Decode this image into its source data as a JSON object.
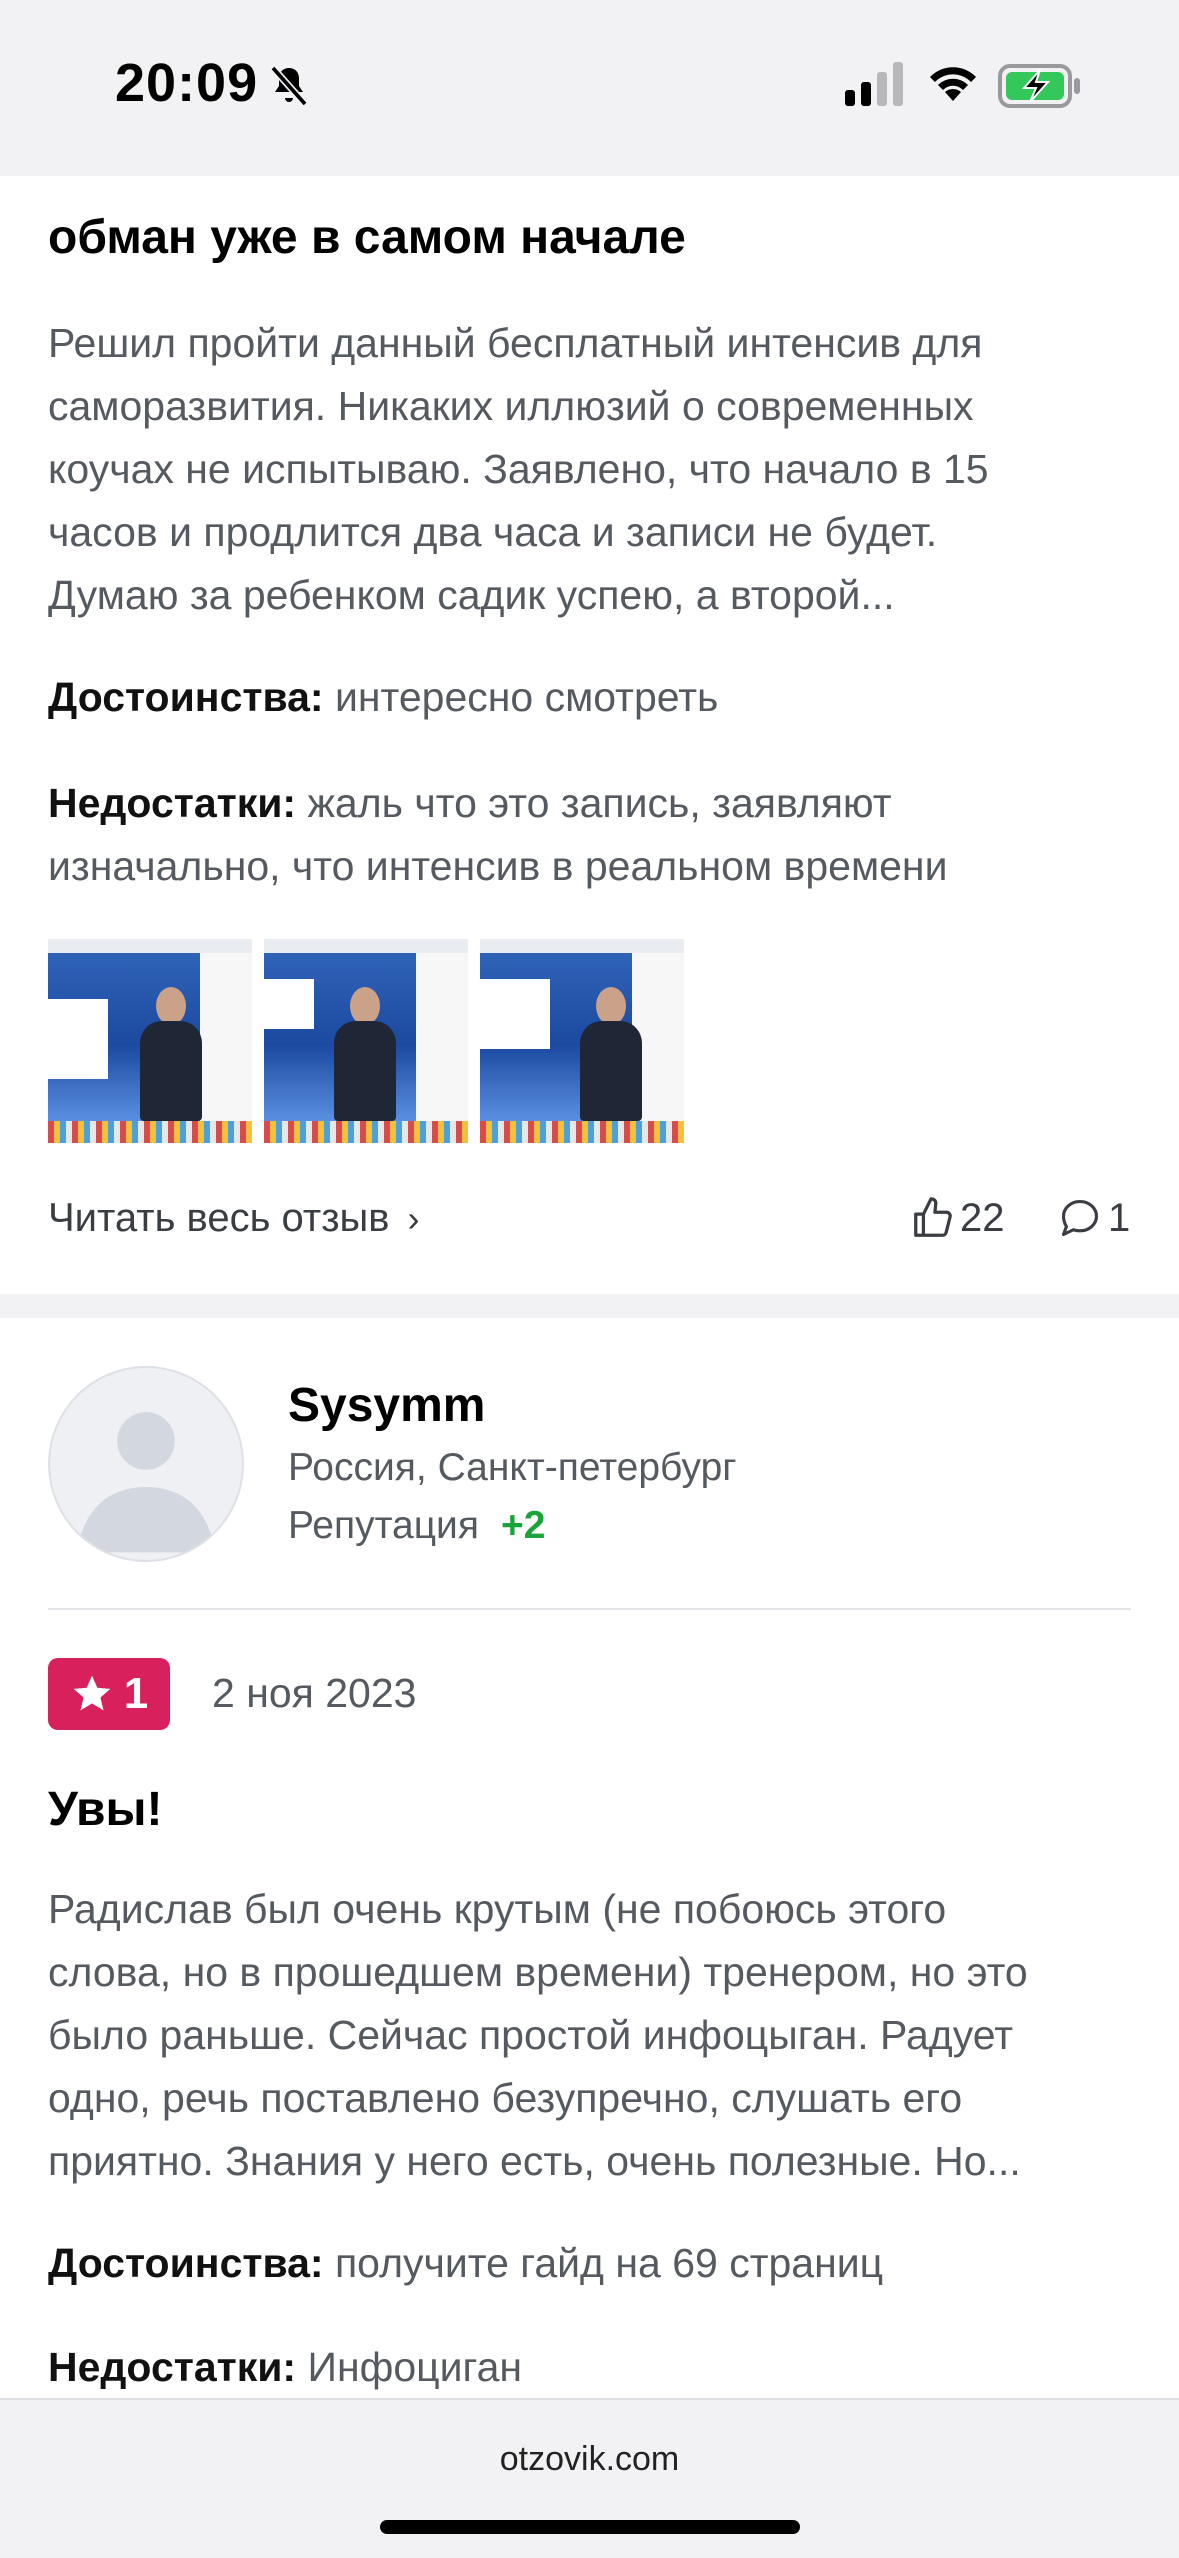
{
  "status": {
    "time": "20:09"
  },
  "review1": {
    "title": "обман уже в самом начале",
    "text_lines": [
      "Решил пройти данный бесплатный интенсив для",
      "саморазвития. Никаких иллюзий о современных",
      "коучах не испытываю. Заявлено, что начало в 15",
      "часов и продлится два часа и записи не будет.",
      "Думаю за ребенком садик успею, а второй..."
    ],
    "pros_label": "Достоинства:",
    "pros_text": "интересно смотреть",
    "cons_label": "Недостатки:",
    "cons_text_line1": "жаль что это запись, заявляют",
    "cons_text_line2": "изначально, что интенсив в реальном времени",
    "read_all": "Читать весь отзыв",
    "likes": "22",
    "comments": "1"
  },
  "review2": {
    "username": "Sysymm",
    "location": "Россия, Санкт-петербург",
    "reputation_label": "Репутация",
    "reputation_value": "+2",
    "rating": "1",
    "date": "2 ноя 2023",
    "title": "Увы!",
    "text_lines": [
      "Радислав был очень крутым (не побоюсь этого",
      "слова, но в прошедшем времени) тренером, но это",
      "было раньше. Сейчас простой инфоцыган. Радует",
      "одно, речь поставлено безупречно, слушать его",
      "приятно. Знания у него есть, очень полезные. Но..."
    ],
    "pros_label": "Достоинства:",
    "pros_text": "получите гайд на 69 страниц",
    "cons_label": "Недостатки:",
    "cons_text": "Инфоциган"
  },
  "footer": {
    "site": "otzovik.com"
  },
  "colors": {
    "rating_bg": "#d8215c",
    "reputation_positive": "#1aa33a"
  }
}
